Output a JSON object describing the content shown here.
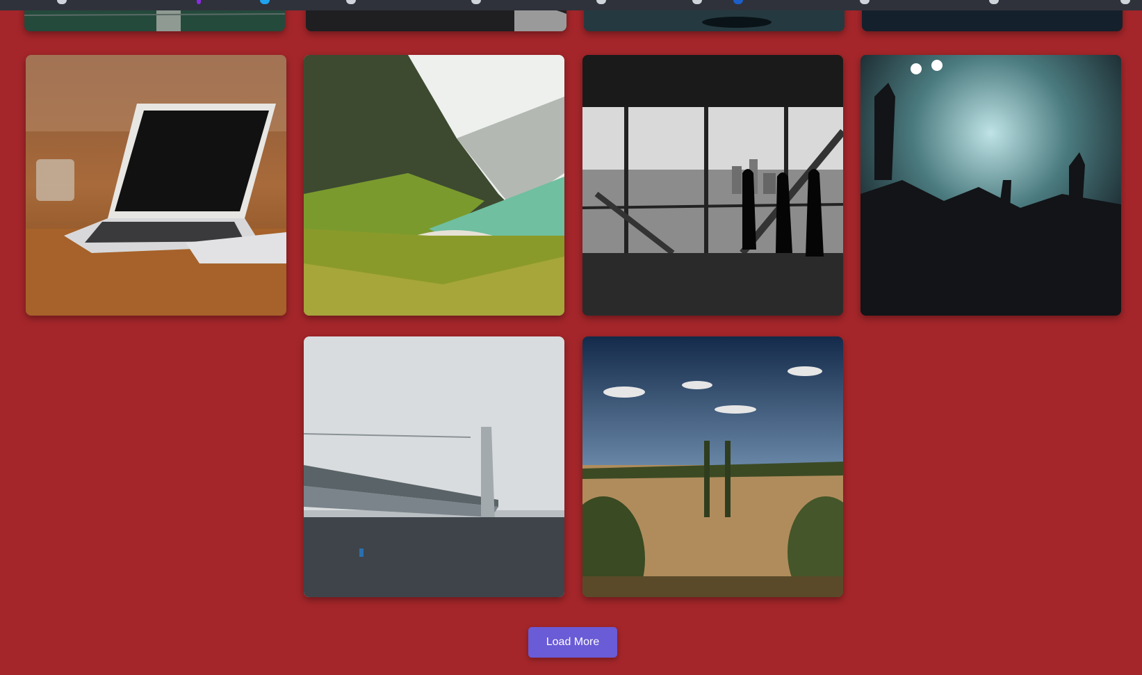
{
  "page": {
    "background": "#a4262a"
  },
  "load_more": {
    "label": "Load More",
    "color": "#6a5bd6"
  },
  "gallery": {
    "images": [
      {
        "name": "forest-boardwalk",
        "state": "partially-visible"
      },
      {
        "name": "stormy-sea",
        "state": "partially-visible"
      },
      {
        "name": "night-water",
        "state": "partially-visible"
      },
      {
        "name": "dark-sky",
        "state": "partially-visible"
      },
      {
        "name": "laptop-on-desk",
        "state": "visible"
      },
      {
        "name": "mountain-beach",
        "state": "visible"
      },
      {
        "name": "office-skyline-silhouettes",
        "state": "visible"
      },
      {
        "name": "concert-crowd",
        "state": "visible"
      },
      {
        "name": "foggy-bridge",
        "state": "visible"
      },
      {
        "name": "tuscan-cypress-field",
        "state": "visible"
      }
    ]
  }
}
